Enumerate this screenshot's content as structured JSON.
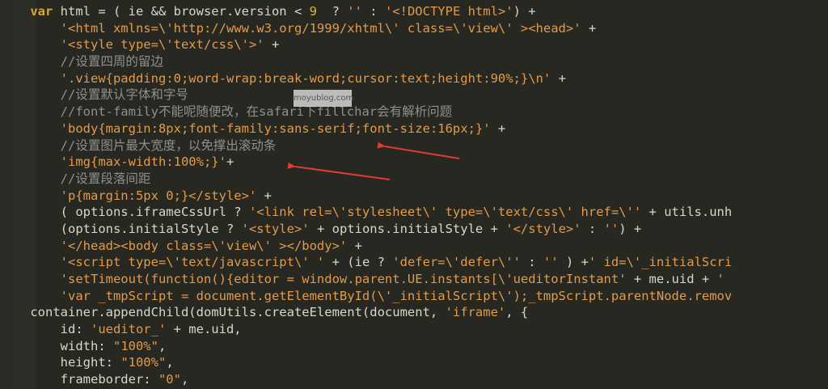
{
  "editor": {
    "lines": [
      [
        [
          "kw",
          "    var"
        ],
        [
          "pl",
          " html = ( ie && browser.version < "
        ],
        [
          "num",
          "9"
        ],
        [
          "pl",
          "  ? "
        ],
        [
          "str",
          "''"
        ],
        [
          "pl",
          " : "
        ],
        [
          "str",
          "'<!DOCTYPE html>'"
        ],
        [
          "pl",
          ") +"
        ]
      ],
      [
        [
          "pl",
          "        "
        ],
        [
          "str",
          "'<html xmlns=\\'http://www.w3.org/1999/xhtml\\' class=\\'view\\' ><head>'"
        ],
        [
          "pl",
          " +"
        ]
      ],
      [
        [
          "pl",
          "        "
        ],
        [
          "str",
          "'<style type=\\'text/css\\'>'"
        ],
        [
          "pl",
          " +"
        ]
      ],
      [
        [
          "pl",
          "        "
        ],
        [
          "cmt",
          "//设置四周的留边"
        ]
      ],
      [
        [
          "pl",
          "        "
        ],
        [
          "str",
          "'.view{padding:0;word-wrap:break-word;cursor:text;height:90%;}\\n'"
        ],
        [
          "pl",
          " +"
        ]
      ],
      [
        [
          "pl",
          "        "
        ],
        [
          "cmt",
          "//设置默认字体和字号"
        ]
      ],
      [
        [
          "pl",
          "        "
        ],
        [
          "cmt",
          "//font-family不能呢随便改，在safari下fillchar会有解析问题"
        ]
      ],
      [
        [
          "pl",
          "        "
        ],
        [
          "str",
          "'body{margin:8px;font-family:sans-serif;font-size:16px;}'"
        ],
        [
          "pl",
          " +"
        ]
      ],
      [
        [
          "pl",
          "        "
        ],
        [
          "cmt",
          "//设置图片最大宽度，以免撑出滚动条"
        ]
      ],
      [
        [
          "pl",
          "        "
        ],
        [
          "str",
          "'img{max-width:100%;}'"
        ],
        [
          "pl",
          "+"
        ]
      ],
      [
        [
          "pl",
          "        "
        ],
        [
          "cmt",
          "//设置段落间距"
        ]
      ],
      [
        [
          "pl",
          "        "
        ],
        [
          "str",
          "'p{margin:5px 0;}</style>'"
        ],
        [
          "pl",
          " +"
        ]
      ],
      [
        [
          "pl",
          "        ( options.iframeCssUrl ? "
        ],
        [
          "str",
          "'<link rel=\\'stylesheet\\' type=\\'text/css\\' href=\\''"
        ],
        [
          "pl",
          " + utils.unh"
        ]
      ],
      [
        [
          "pl",
          "        (options.initialStyle ? "
        ],
        [
          "str",
          "'<style>'"
        ],
        [
          "pl",
          " + options.initialStyle + "
        ],
        [
          "str",
          "'</style>'"
        ],
        [
          "pl",
          " : "
        ],
        [
          "str",
          "''"
        ],
        [
          "pl",
          ") +"
        ]
      ],
      [
        [
          "pl",
          "        "
        ],
        [
          "str",
          "'</head><body class=\\'view\\' ></body>'"
        ],
        [
          "pl",
          " +"
        ]
      ],
      [
        [
          "pl",
          "        "
        ],
        [
          "str",
          "'<script type=\\'text/javascript\\' '"
        ],
        [
          "pl",
          " + (ie ? "
        ],
        [
          "str",
          "'defer=\\'defer\\''"
        ],
        [
          "pl",
          " : "
        ],
        [
          "str",
          "''"
        ],
        [
          "pl",
          " ) +"
        ],
        [
          "str",
          "' id=\\'_initialScri"
        ]
      ],
      [
        [
          "pl",
          "        "
        ],
        [
          "str",
          "'setTimeout(function(){editor = window.parent.UE.instants[\\'ueditorInstant'"
        ],
        [
          "pl",
          " + me.uid + "
        ],
        [
          "str",
          "'"
        ]
      ],
      [
        [
          "pl",
          "        "
        ],
        [
          "str",
          "'var _tmpScript = document.getElementById(\\'_initialScript\\');_tmpScript.parentNode.remov"
        ]
      ],
      [
        [
          "pl",
          "    container.appendChild(domUtils.createElement(document, "
        ],
        [
          "str",
          "'iframe'"
        ],
        [
          "pl",
          ", {"
        ]
      ],
      [
        [
          "pl",
          "        id: "
        ],
        [
          "str",
          "'ueditor_'"
        ],
        [
          "pl",
          " + me.uid,"
        ]
      ],
      [
        [
          "pl",
          "        width: "
        ],
        [
          "str",
          "\"100%\""
        ],
        [
          "pl",
          ","
        ]
      ],
      [
        [
          "pl",
          "        height: "
        ],
        [
          "str",
          "\"100%\""
        ],
        [
          "pl",
          ","
        ]
      ],
      [
        [
          "pl",
          "        frameborder: "
        ],
        [
          "str",
          "\"0\""
        ],
        [
          "pl",
          ","
        ]
      ]
    ]
  },
  "watermark": {
    "text": "moyublog.com"
  },
  "annotations": {
    "arrow_color": "#e53935"
  }
}
